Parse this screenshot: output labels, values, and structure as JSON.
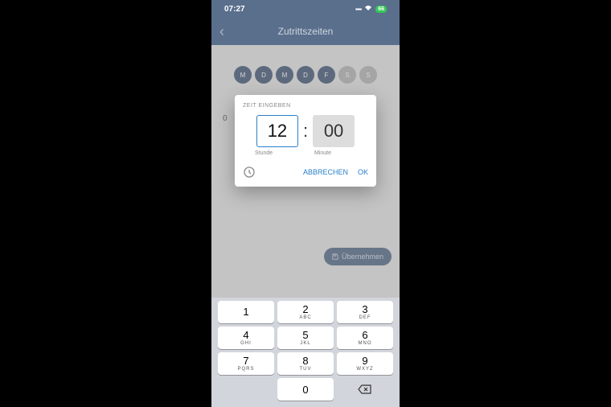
{
  "statusbar": {
    "time": "07:27",
    "battery": "66"
  },
  "header": {
    "title": "Zutrittszeiten"
  },
  "days": [
    {
      "label": "M",
      "active": true
    },
    {
      "label": "D",
      "active": true
    },
    {
      "label": "M",
      "active": true
    },
    {
      "label": "D",
      "active": true
    },
    {
      "label": "F",
      "active": true
    },
    {
      "label": "S",
      "active": false
    },
    {
      "label": "S",
      "active": false
    }
  ],
  "extra": {
    "zero": "0"
  },
  "apply": {
    "label": "Übernehmen"
  },
  "dialog": {
    "title": "ZEIT EINGEBEN",
    "hour": "12",
    "minute": "00",
    "hour_label": "Stunde",
    "minute_label": "Minute",
    "cancel": "ABBRECHEN",
    "ok": "OK"
  },
  "keypad": {
    "keys": [
      {
        "d": "1",
        "l": ""
      },
      {
        "d": "2",
        "l": "ABC"
      },
      {
        "d": "3",
        "l": "DEF"
      },
      {
        "d": "4",
        "l": "GHI"
      },
      {
        "d": "5",
        "l": "JKL"
      },
      {
        "d": "6",
        "l": "MNO"
      },
      {
        "d": "7",
        "l": "PQRS"
      },
      {
        "d": "8",
        "l": "TUV"
      },
      {
        "d": "9",
        "l": "WXYZ"
      },
      {
        "d": "0",
        "l": ""
      }
    ]
  }
}
